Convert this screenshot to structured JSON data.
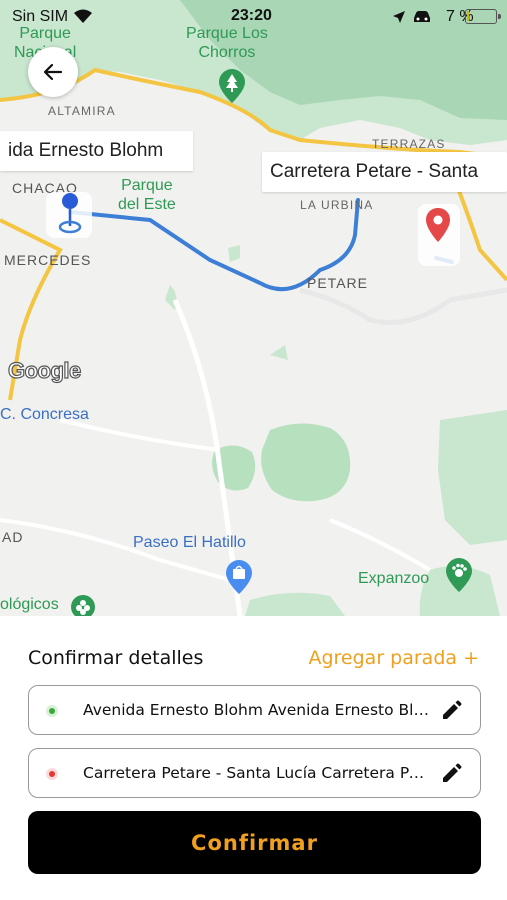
{
  "status_bar": {
    "carrier": "Sin SIM",
    "time": "23:20",
    "battery_percent": "7 %",
    "battery_level": 0.07
  },
  "map": {
    "labels": {
      "parque_nacional": "Parque\nNacional\nEl",
      "parque_los_chorros": "Parque Los\nChorros",
      "altamira": "ALTAMIRA",
      "terrazas": "TERRAZAS",
      "chacao": "CHACAO",
      "parque_del_este": "Parque\ndel Este",
      "la_urbina": "LA URBINA",
      "mercedes": "MERCEDES",
      "petare": "PETARE",
      "concresa": "C. Concresa",
      "ad": "AD",
      "paseo_el_hatillo": "Paseo El Hatillo",
      "expanzoo": "Expanzoo",
      "ologicos": "ológicos"
    },
    "google_logo": "Google",
    "start_callout": "ida Ernesto Blohm",
    "end_callout": "Carretera Petare - Santa"
  },
  "panel": {
    "title": "Confirmar detalles",
    "add_stop": "Agregar parada +",
    "origin": "Avenida Ernesto Blohm Avenida Ernesto Blohm",
    "destination": "Carretera Petare - Santa Lucía Carretera Petare",
    "confirm_label": "Confirmar"
  },
  "colors": {
    "accent": "#f0a020",
    "route": "#3d7fd6",
    "origin_dot": "#3aa83a",
    "destination_dot": "#e53935"
  }
}
